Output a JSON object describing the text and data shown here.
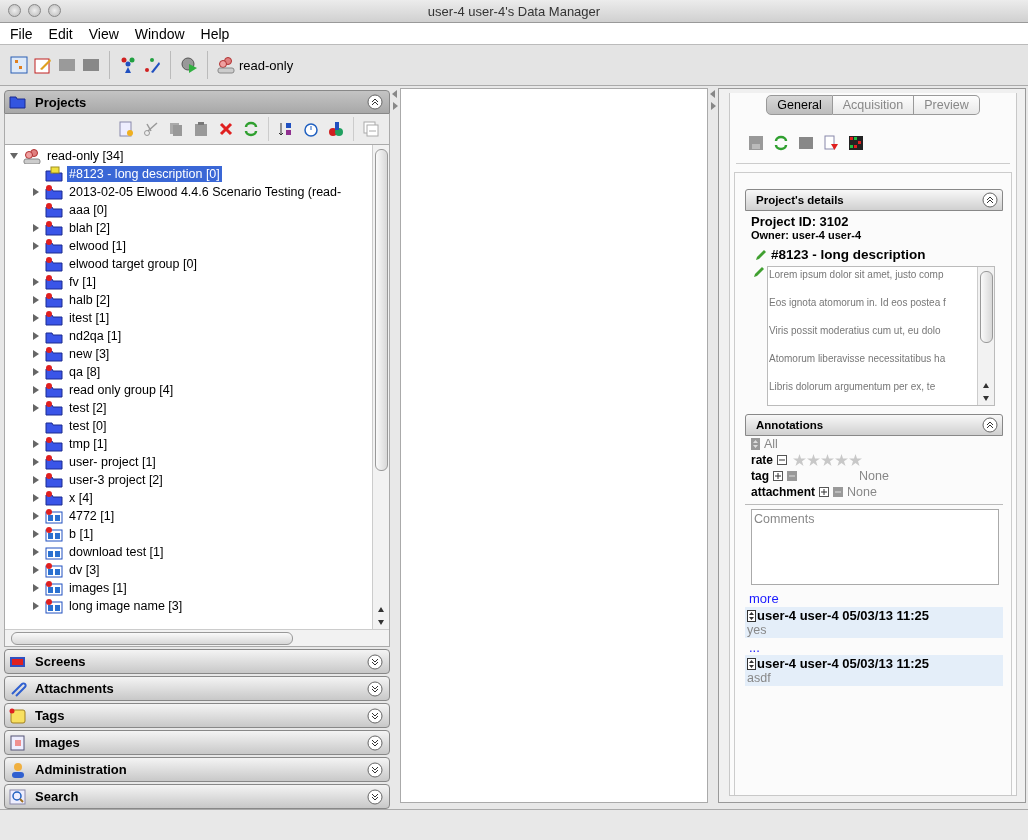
{
  "window": {
    "title": "user-4 user-4's Data Manager"
  },
  "menu": [
    "File",
    "Edit",
    "View",
    "Window",
    "Help"
  ],
  "toolbar": {
    "group_label": "read-only"
  },
  "projects_panel": {
    "title": "Projects",
    "expanded": true,
    "tree": {
      "label": "read-only [34]",
      "kind": "group",
      "expanded": true,
      "selected": false,
      "children": [
        {
          "label": "#8123 - long description [0]",
          "kind": "annotated",
          "marked": false,
          "expandable": false,
          "selected": true
        },
        {
          "label": "2013-02-05 Elwood 4.4.6 Scenario Testing (read-",
          "kind": "project",
          "marked": true,
          "expandable": true,
          "selected": false
        },
        {
          "label": "aaa [0]",
          "kind": "project",
          "marked": true,
          "expandable": false,
          "selected": false
        },
        {
          "label": "blah [2]",
          "kind": "project",
          "marked": true,
          "expandable": true,
          "selected": false
        },
        {
          "label": "elwood [1]",
          "kind": "project",
          "marked": true,
          "expandable": true,
          "selected": false
        },
        {
          "label": "elwood target group [0]",
          "kind": "project",
          "marked": true,
          "expandable": false,
          "selected": false
        },
        {
          "label": "fv [1]",
          "kind": "project",
          "marked": true,
          "expandable": true,
          "selected": false
        },
        {
          "label": "halb [2]",
          "kind": "project",
          "marked": true,
          "expandable": true,
          "selected": false
        },
        {
          "label": "itest [1]",
          "kind": "project",
          "marked": true,
          "expandable": true,
          "selected": false
        },
        {
          "label": "nd2qa [1]",
          "kind": "project",
          "marked": false,
          "expandable": true,
          "selected": false
        },
        {
          "label": "new [3]",
          "kind": "project",
          "marked": true,
          "expandable": true,
          "selected": false
        },
        {
          "label": "qa [8]",
          "kind": "project",
          "marked": true,
          "expandable": true,
          "selected": false
        },
        {
          "label": "read only group [4]",
          "kind": "project",
          "marked": true,
          "expandable": true,
          "selected": false
        },
        {
          "label": "test [2]",
          "kind": "project",
          "marked": true,
          "expandable": true,
          "selected": false
        },
        {
          "label": "test [0]",
          "kind": "project",
          "marked": false,
          "expandable": false,
          "selected": false
        },
        {
          "label": "tmp [1]",
          "kind": "project",
          "marked": true,
          "expandable": true,
          "selected": false
        },
        {
          "label": "user- project [1]",
          "kind": "project",
          "marked": true,
          "expandable": true,
          "selected": false
        },
        {
          "label": "user-3 project [2]",
          "kind": "project",
          "marked": true,
          "expandable": true,
          "selected": false
        },
        {
          "label": "x [4]",
          "kind": "project",
          "marked": true,
          "expandable": true,
          "selected": false
        },
        {
          "label": "4772 [1]",
          "kind": "screen",
          "marked": true,
          "expandable": true,
          "selected": false
        },
        {
          "label": "b [1]",
          "kind": "screen",
          "marked": true,
          "expandable": true,
          "selected": false
        },
        {
          "label": "download test [1]",
          "kind": "screen",
          "marked": false,
          "expandable": true,
          "selected": false
        },
        {
          "label": "dv [3]",
          "kind": "screen",
          "marked": true,
          "expandable": true,
          "selected": false
        },
        {
          "label": "images [1]",
          "kind": "screen",
          "marked": true,
          "expandable": true,
          "selected": false
        },
        {
          "label": "long image name [3]",
          "kind": "screen",
          "marked": true,
          "expandable": true,
          "selected": false
        }
      ]
    }
  },
  "collapsed_panels": [
    {
      "title": "Screens",
      "kind": "screens",
      "expanded": false
    },
    {
      "title": "Attachments",
      "kind": "attachments",
      "expanded": false
    },
    {
      "title": "Tags",
      "kind": "tags",
      "expanded": false
    },
    {
      "title": "Images",
      "kind": "images",
      "expanded": false
    },
    {
      "title": "Administration",
      "kind": "administration",
      "expanded": false
    },
    {
      "title": "Search",
      "kind": "search",
      "expanded": false
    }
  ],
  "details": {
    "tabs": [
      {
        "label": "General",
        "selected": true
      },
      {
        "label": "Acquisition",
        "selected": false
      },
      {
        "label": "Preview",
        "selected": false
      }
    ],
    "section_title": "Project's details",
    "section_expanded": true,
    "project_id": "Project ID: 3102",
    "owner": "Owner: user-4 user-4",
    "name": "#8123 - long description",
    "description_lines": [
      "Lorem ipsum dolor sit amet, justo comp",
      "Eos ignota atomorum in. Id eos postea f",
      "Viris possit moderatius cum ut, eu dolo",
      "Atomorum liberavisse necessitatibus ha",
      "Libris dolorum argumentum per ex, te"
    ],
    "annotations": {
      "title": "Annotations",
      "expanded": true,
      "filter": "All",
      "rate": {
        "label": "rate",
        "stars": 0
      },
      "tag": {
        "label": "tag",
        "value": "None"
      },
      "attachment": {
        "label": "attachment",
        "value": "None"
      },
      "comment_placeholder": "Comments",
      "more_link": "more",
      "comments": [
        {
          "header": "user-4 user-4 05/03/13 11:25",
          "text": "yes"
        },
        {
          "header": "user-4 user-4 05/03/13 11:25",
          "text": "asdf"
        }
      ],
      "ellipsis_link": "..."
    }
  }
}
